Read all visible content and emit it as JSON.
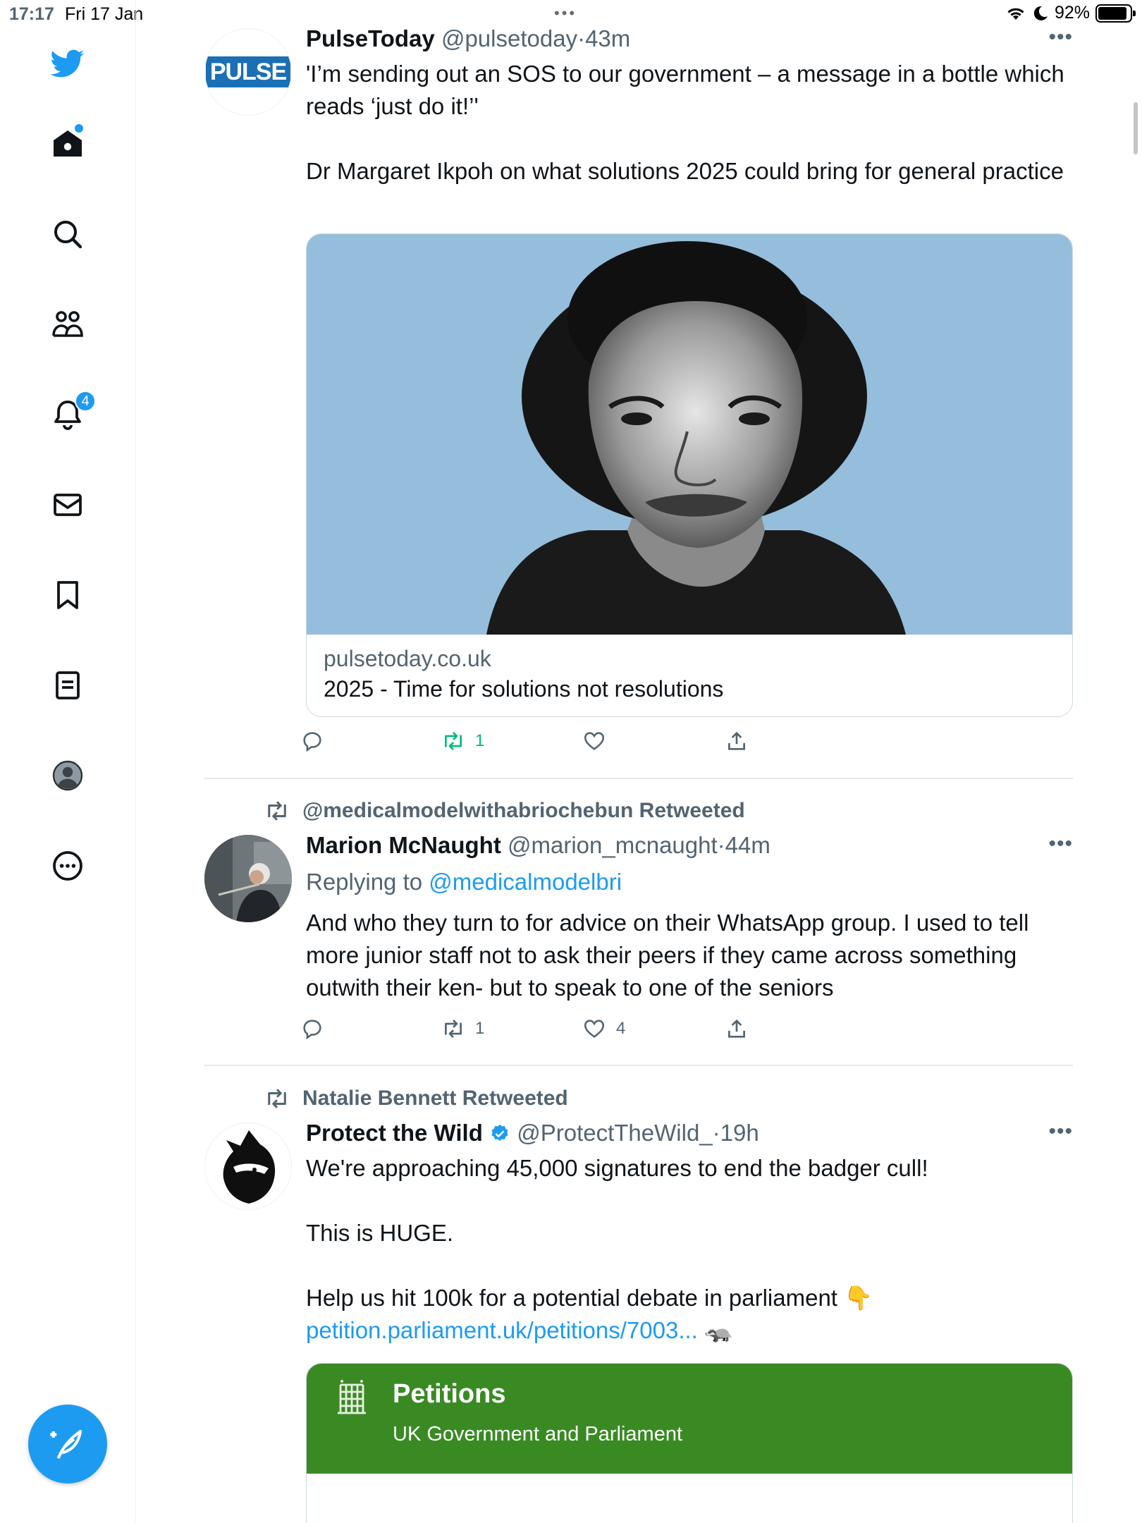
{
  "status_bar": {
    "time": "17:17",
    "date": "Fri 17 Jan",
    "battery": "92%"
  },
  "sidebar": {
    "notifications_badge": "4",
    "items": [
      {
        "icon": "twitter-logo-icon"
      },
      {
        "icon": "home-icon"
      },
      {
        "icon": "search-icon"
      },
      {
        "icon": "communities-icon"
      },
      {
        "icon": "notifications-bell-icon"
      },
      {
        "icon": "messages-envelope-icon"
      },
      {
        "icon": "bookmark-icon"
      },
      {
        "icon": "lists-icon"
      },
      {
        "icon": "profile-avatar-icon"
      },
      {
        "icon": "more-options-icon"
      }
    ],
    "compose_icon": "compose-feather-icon"
  },
  "colors": {
    "accent": "#1d9bf0",
    "retweet_active": "#00ba7c",
    "secondary_text": "#536471",
    "petitions_green": "#3a8a24",
    "pulse_image_bg": "#94bedb"
  },
  "tweets": [
    {
      "name": "PulseToday",
      "handle": "@pulsetoday",
      "separator": "·",
      "time": "43m",
      "avatar_text": "PULSE",
      "text_lines": [
        "'I’m sending out an SOS to our government – a message in a bottle which reads ‘just do it!’'",
        "Dr Margaret Ikpoh on what solutions 2025 could bring for general practice"
      ],
      "card": {
        "domain": "pulsetoday.co.uk",
        "title": "2025 - Time for solutions not resolutions"
      },
      "retweet_count": "1"
    },
    {
      "retweeted_by": "@medicalmodelwithabriochebun Retweeted",
      "name": "Marion McNaught",
      "handle": "@marion_mcnaught",
      "separator": "·",
      "time": "44m",
      "replying_prefix": "Replying to ",
      "replying_to": "@medicalmodelbri",
      "text": "And who they turn to for advice on their WhatsApp group. I used to tell more junior staff not to ask their peers if they came across something outwith their ken- but to speak to one of the seniors",
      "retweet_count": "1",
      "like_count": "4"
    },
    {
      "retweeted_by": "Natalie Bennett Retweeted",
      "name": "Protect the Wild",
      "verified": true,
      "handle": "@ProtectTheWild_",
      "separator": "·",
      "time": "19h",
      "text_lines": [
        "We're approaching 45,000 signatures to end the badger cull!",
        "This is HUGE.",
        "Help us hit 100k for a potential debate in parliament 👇"
      ],
      "link": "petition.parliament.uk/petitions/7003...",
      "link_emoji": "🦡",
      "card": {
        "title": "Petitions",
        "subtitle": "UK Government and Parliament"
      }
    }
  ]
}
